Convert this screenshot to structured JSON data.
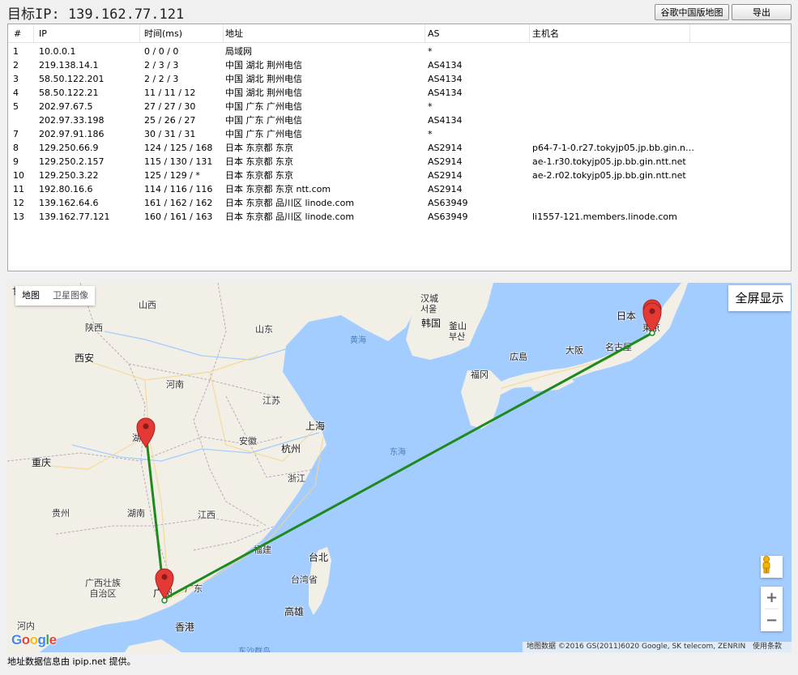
{
  "header": {
    "title": "目标IP: 139.162.77.121",
    "map_button": "谷歌中国版地图",
    "export_button": "导出"
  },
  "table": {
    "columns": [
      "#",
      "IP",
      "时间(ms)",
      "地址",
      "AS",
      "主机名"
    ],
    "rows": [
      {
        "n": "1",
        "ip": "10.0.0.1",
        "time": "0 / 0 / 0",
        "loc": "局域网",
        "as": "*",
        "host": ""
      },
      {
        "n": "2",
        "ip": "219.138.14.1",
        "time": "2 / 3 / 3",
        "loc": "中国 湖北 荆州电信",
        "as": "AS4134",
        "host": ""
      },
      {
        "n": "3",
        "ip": "58.50.122.201",
        "time": "2 / 2 / 3",
        "loc": "中国 湖北 荆州电信",
        "as": "AS4134",
        "host": ""
      },
      {
        "n": "4",
        "ip": "58.50.122.21",
        "time": "11 / 11 / 12",
        "loc": "中国 湖北 荆州电信",
        "as": "AS4134",
        "host": ""
      },
      {
        "n": "5",
        "ip": "202.97.67.5",
        "time": "27 / 27 / 30",
        "loc": "中国 广东 广州电信",
        "as": "*",
        "host": ""
      },
      {
        "n": "",
        "ip": "202.97.33.198",
        "time": "25 / 26 / 27",
        "loc": "中国 广东 广州电信",
        "as": "AS4134",
        "host": ""
      },
      {
        "n": "7",
        "ip": "202.97.91.186",
        "time": "30 / 31 / 31",
        "loc": "中国 广东 广州电信",
        "as": "*",
        "host": ""
      },
      {
        "n": "8",
        "ip": "129.250.66.9",
        "time": "124 / 125 / 168",
        "loc": "日本 东京都 东京",
        "as": "AS2914",
        "host": "p64-7-1-0.r27.tokyjp05.jp.bb.gin.nt..."
      },
      {
        "n": "9",
        "ip": "129.250.2.157",
        "time": "115 / 130 / 131",
        "loc": "日本 东京都 东京",
        "as": "AS2914",
        "host": "ae-1.r30.tokyjp05.jp.bb.gin.ntt.net"
      },
      {
        "n": "10",
        "ip": "129.250.3.22",
        "time": "125 / 129 / *",
        "loc": "日本 东京都 东京",
        "as": "AS2914",
        "host": "ae-2.r02.tokyjp05.jp.bb.gin.ntt.net"
      },
      {
        "n": "11",
        "ip": "192.80.16.6",
        "time": "114 / 116 / 116",
        "loc": "日本 东京都 东京 ntt.com",
        "as": "AS2914",
        "host": ""
      },
      {
        "n": "12",
        "ip": "139.162.64.6",
        "time": "161 / 162 / 162",
        "loc": "日本 东京都 品川区 linode.com",
        "as": "AS63949",
        "host": ""
      },
      {
        "n": "13",
        "ip": "139.162.77.121",
        "time": "160 / 161 / 163",
        "loc": "日本 东京都 品川区 linode.com",
        "as": "AS63949",
        "host": "li1557-121.members.linode.com"
      }
    ]
  },
  "map": {
    "type_map": "地图",
    "type_satellite": "卫星图像",
    "fullscreen": "全屏显示",
    "zoom_in": "+",
    "zoom_out": "−",
    "google": "Google",
    "attribution": "地图数据 ©2016 GS(2011)6020 Google, SK telecom, ZENRIN",
    "terms": "使用条款",
    "route_color": "#1e8a1e",
    "marker_color": "#e53935",
    "labels": {
      "shaanxi": "陕西",
      "shanxi": "山西",
      "shandong": "山东",
      "henan": "河南",
      "jiangsu": "江苏",
      "anhui": "安徽",
      "zhejiang": "浙江",
      "jiangxi": "江西",
      "hunan": "湖南",
      "guizhou": "贵州",
      "fujian": "福建",
      "guangdong": "广东",
      "guangxi": "广西壮族\n自治区",
      "hubei": "湖北",
      "chongqing": "重庆",
      "xian": "西安",
      "shanghai": "上海",
      "hangzhou": "杭州",
      "taibei": "台北",
      "taiwan": "台湾省",
      "gaoxiong": "高雄",
      "hongkong": "香港",
      "guangzhou": "广州",
      "hanoi": "河内",
      "gansu": "甘肃",
      "yellow_sea": "黄海",
      "east_sea": "东海",
      "south_sea": "东沙群岛",
      "seoul": "汉城\n서울",
      "korea": "韩国",
      "busan": "釜山\n부산",
      "fukuoka": "福冈",
      "hiroshima": "広島",
      "osaka": "大阪",
      "nagoya": "名古屋",
      "japan": "日本",
      "tokyo": "東京"
    }
  },
  "footer": {
    "text": "地址数据信息由 ipip.net 提供。"
  }
}
